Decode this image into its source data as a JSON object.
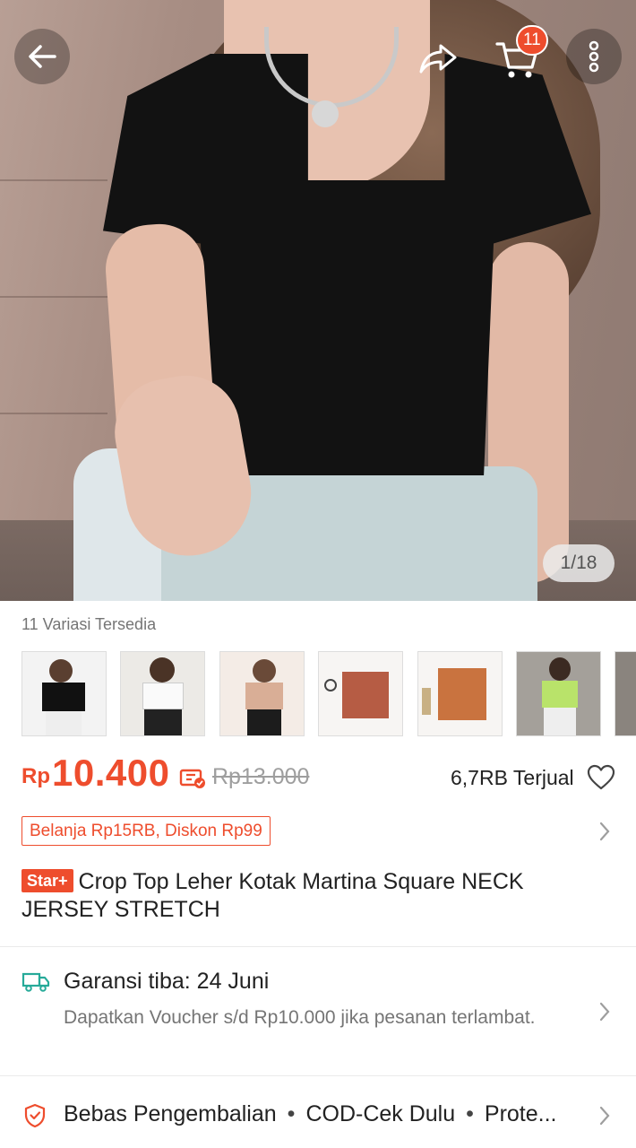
{
  "header": {
    "cart_count": "11",
    "image_pager": "1/18"
  },
  "variations": {
    "title": "11 Variasi Tersedia",
    "thumbnails": [
      {
        "icon": "model-black-top"
      },
      {
        "icon": "model-white-top"
      },
      {
        "icon": "model-beige-top"
      },
      {
        "icon": "flatlay-brick-top"
      },
      {
        "icon": "flatlay-orange-top"
      },
      {
        "icon": "model-lime-top"
      },
      {
        "icon": "model-partial"
      }
    ]
  },
  "price": {
    "currency": "Rp",
    "current": "10.400",
    "original": "Rp13.000",
    "sold": "6,7RB Terjual"
  },
  "promo": {
    "label": "Belanja Rp15RB, Diskon Rp99"
  },
  "product": {
    "tag": "Star+",
    "title": "Crop Top Leher Kotak Martina Square NECK JERSEY STRETCH"
  },
  "shipping": {
    "title": "Garansi tiba: 24 Juni",
    "subtitle": "Dapatkan Voucher s/d Rp10.000 jika pesanan terlambat."
  },
  "guarantees": {
    "items": [
      "Bebas Pengembalian",
      "COD-Cek Dulu",
      "Prote..."
    ]
  },
  "colors": {
    "accent": "#ee4d2d",
    "teal": "#26aa99"
  }
}
